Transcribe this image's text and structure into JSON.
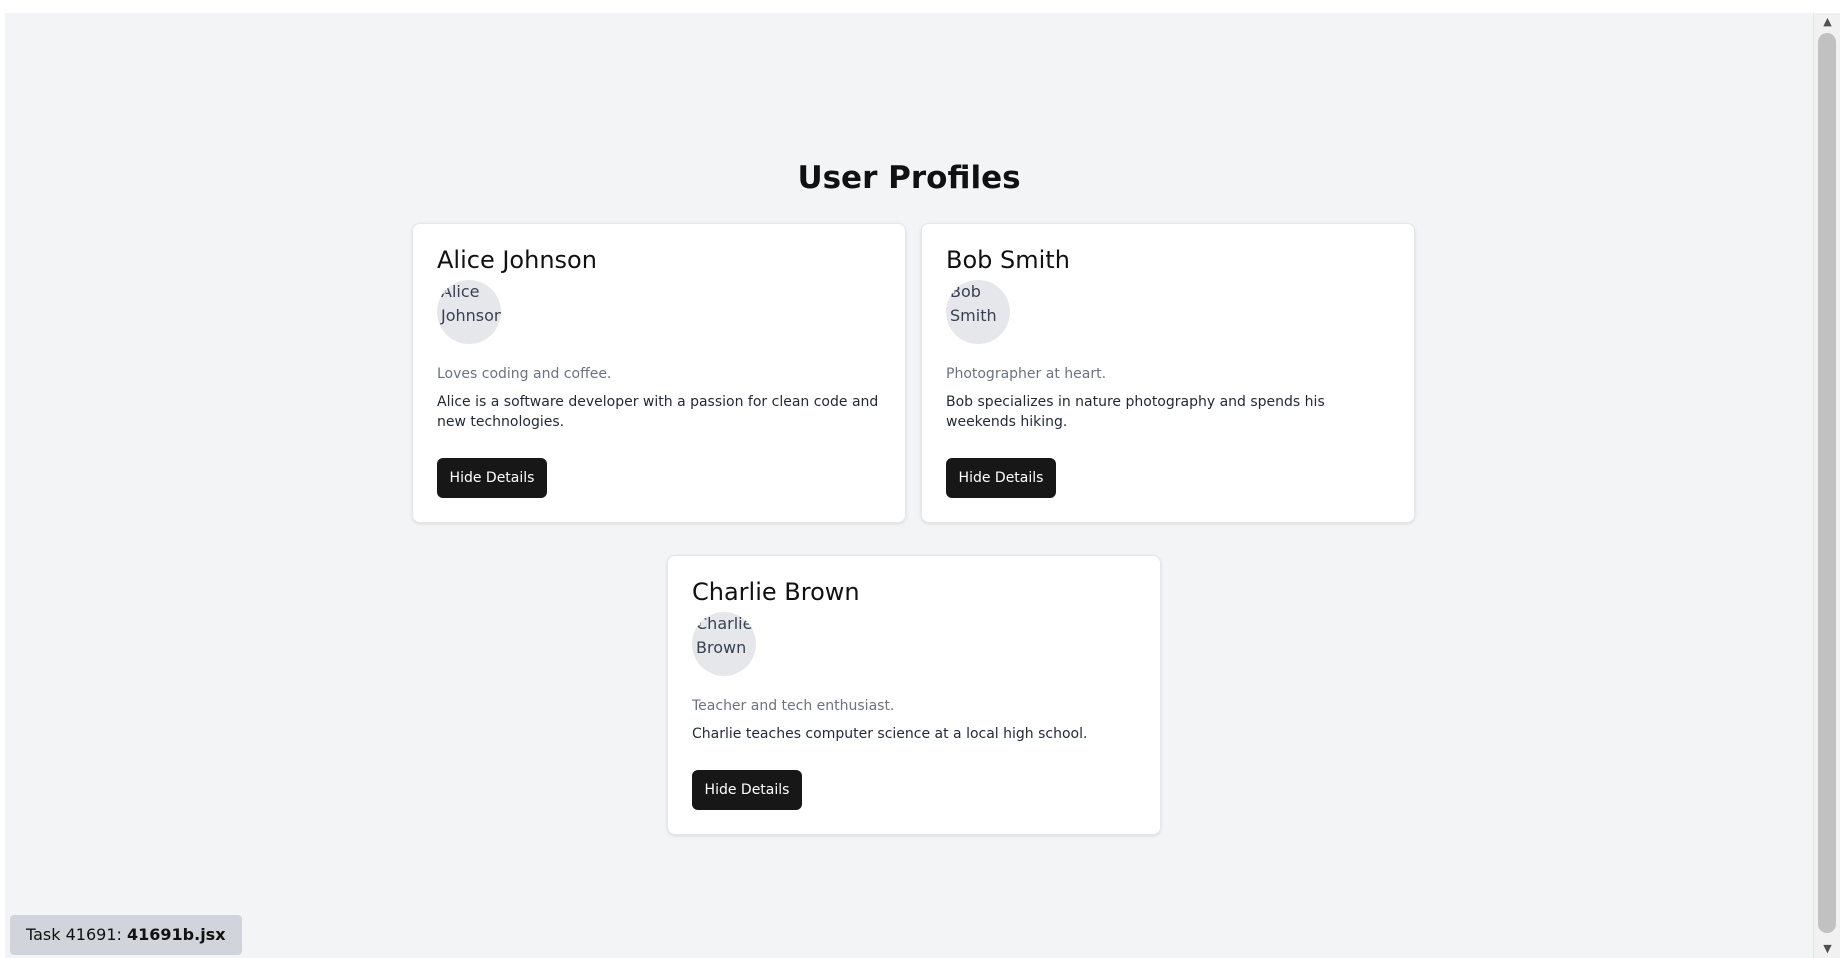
{
  "page": {
    "title": "User Profiles"
  },
  "profiles": [
    {
      "name": "Alice Johnson",
      "avatar_alt": "Alice Johnson",
      "bio": "Loves coding and coffee.",
      "details": "Alice is a software developer with a passion for clean code and new technologies.",
      "toggle_label": "Hide Details"
    },
    {
      "name": "Bob Smith",
      "avatar_alt": "Bob Smith",
      "bio": "Photographer at heart.",
      "details": "Bob specializes in nature photography and spends his weekends hiking.",
      "toggle_label": "Hide Details"
    },
    {
      "name": "Charlie Brown",
      "avatar_alt": "Charlie Brown",
      "bio": "Teacher and tech enthusiast.",
      "details": "Charlie teaches computer science at a local high school.",
      "toggle_label": "Hide Details"
    }
  ],
  "task": {
    "prefix": "Task 41691:",
    "file": "41691b.jsx"
  },
  "colors": {
    "background": "#f3f4f6",
    "card": "#ffffff",
    "button": "#171717",
    "avatar_placeholder": "#e5e7eb"
  }
}
